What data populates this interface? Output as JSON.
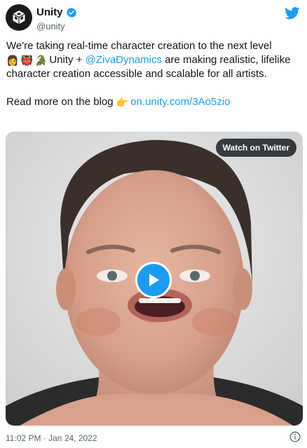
{
  "header": {
    "name": "Unity",
    "handle": "@unity",
    "avatar_icon": "unity-logo-icon",
    "verified_icon": "verified-badge-icon",
    "brand_icon": "twitter-bird-icon"
  },
  "tweet": {
    "line1": "We're taking real-time character creation to the next level",
    "emojis": [
      "👩",
      "👹",
      "🐊"
    ],
    "mention_prefix": "Unity + ",
    "mention": "@ZivaDynamics",
    "line2_rest": " are making realistic, lifelike character creation accessible and scalable for all artists.",
    "read_more": "Read more on the blog ",
    "pointing_emoji": "👉",
    "blog_link": "on.unity.com/3Ao5zio"
  },
  "media": {
    "watch_label": "Watch on Twitter",
    "play_icon": "play-icon"
  },
  "footer": {
    "timestamp": "11:02 PM · Jan 24, 2022",
    "info_icon": "info-icon"
  },
  "colors": {
    "link": "#1d9bf0",
    "text": "#0f1419",
    "secondary": "#536471"
  }
}
